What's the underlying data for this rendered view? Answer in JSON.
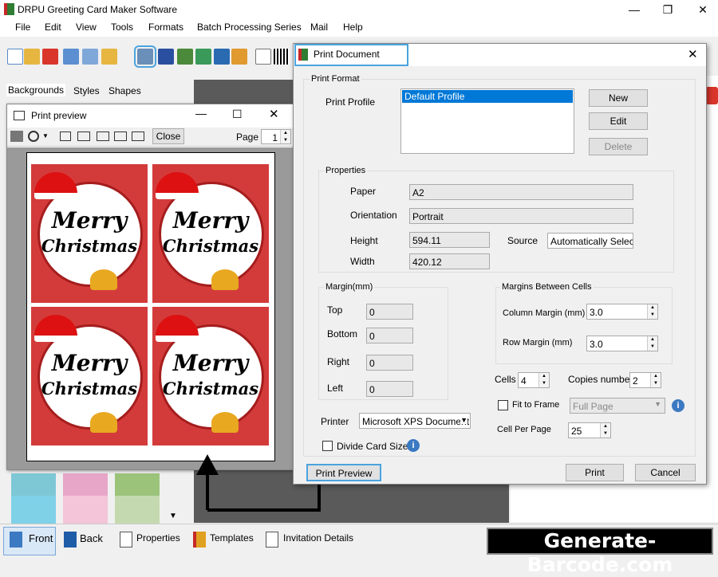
{
  "app": {
    "title": "DRPU Greeting Card Maker Software"
  },
  "menu": [
    "File",
    "Edit",
    "View",
    "Tools",
    "Formats",
    "Batch Processing Series",
    "Mail",
    "Help"
  ],
  "left_tabs": [
    "Backgrounds",
    "Styles",
    "Shapes"
  ],
  "bottom": {
    "front": "Front",
    "back": "Back",
    "properties": "Properties",
    "templates": "Templates",
    "invitation": "Invitation Details"
  },
  "watermark": "Generate-Barcode.com",
  "preview": {
    "title": "Print preview",
    "close_label": "Close",
    "page_label": "Page",
    "page_value": "1",
    "card_line1": "Merry",
    "card_line2": "Christmas"
  },
  "dialog": {
    "title": "Print Document",
    "print_format_legend": "Print Format",
    "print_profile_label": "Print Profile",
    "profiles": [
      "Default Profile"
    ],
    "new_label": "New",
    "edit_label": "Edit",
    "delete_label": "Delete",
    "properties_legend": "Properties",
    "paper_label": "Paper",
    "paper_value": "A2",
    "orientation_label": "Orientation",
    "orientation_value": "Portrait",
    "height_label": "Height",
    "height_value": "594.11",
    "width_label": "Width",
    "width_value": "420.12",
    "source_label": "Source",
    "source_value": "Automatically Select",
    "margin_legend": "Margin(mm)",
    "top_label": "Top",
    "top_value": "0",
    "bottom_label": "Bottom",
    "bottom_value": "0",
    "right_label": "Right",
    "right_value": "0",
    "left_label": "Left",
    "left_value": "0",
    "cells_legend": "Margins Between Cells",
    "column_margin_label": "Column Margin (mm)",
    "column_margin_value": "3.0",
    "row_margin_label": "Row Margin (mm)",
    "row_margin_value": "3.0",
    "cells_label": "Cells",
    "cells_value": "4",
    "copies_label": "Copies number",
    "copies_value": "2",
    "fit_label": "Fit to Frame",
    "fit_value": "Full Page",
    "cell_per_page_label": "Cell Per Page",
    "cell_per_page_value": "25",
    "printer_label": "Printer",
    "printer_value": "Microsoft XPS Document Writer",
    "divide_label": "Divide Card Size",
    "print_preview_label": "Print Preview",
    "print_label": "Print",
    "cancel_label": "Cancel"
  }
}
